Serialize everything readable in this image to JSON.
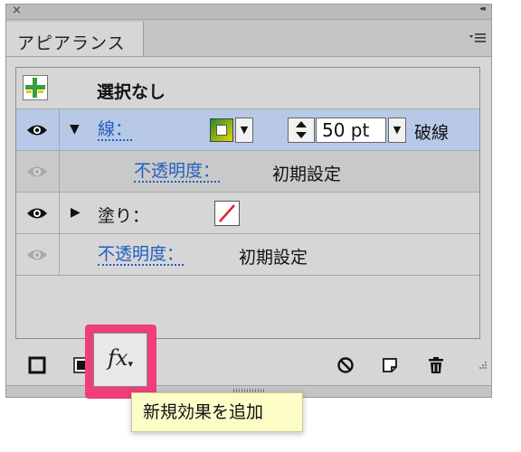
{
  "window": {
    "close_glyph": "×",
    "collapse_glyph": "◂◂",
    "tab_label": "アピアランス",
    "menu_icon": "panel-menu-icon"
  },
  "header_row": {
    "label": "選択なし",
    "icon": "object-thumbnail-icon"
  },
  "rows": {
    "stroke": {
      "label": "線：",
      "width_value": "50 pt",
      "style_value": "破線",
      "colors": {
        "swatch_frame": "#2a8a2a",
        "swatch_inner": "#e8d600"
      }
    },
    "stroke_opacity": {
      "label": "不透明度：",
      "value": "初期設定"
    },
    "fill": {
      "label": "塗り：",
      "swatch_color": "none"
    },
    "opacity": {
      "label": "不透明度：",
      "value": "初期設定"
    }
  },
  "footer": {
    "fx_label": "fx",
    "tooltip": "新規効果を追加"
  },
  "colors": {
    "selection": "#b7c9e6",
    "link": "#1f5fc4",
    "highlight": "#f23d7c",
    "tooltip_bg": "#fdfdc8"
  }
}
